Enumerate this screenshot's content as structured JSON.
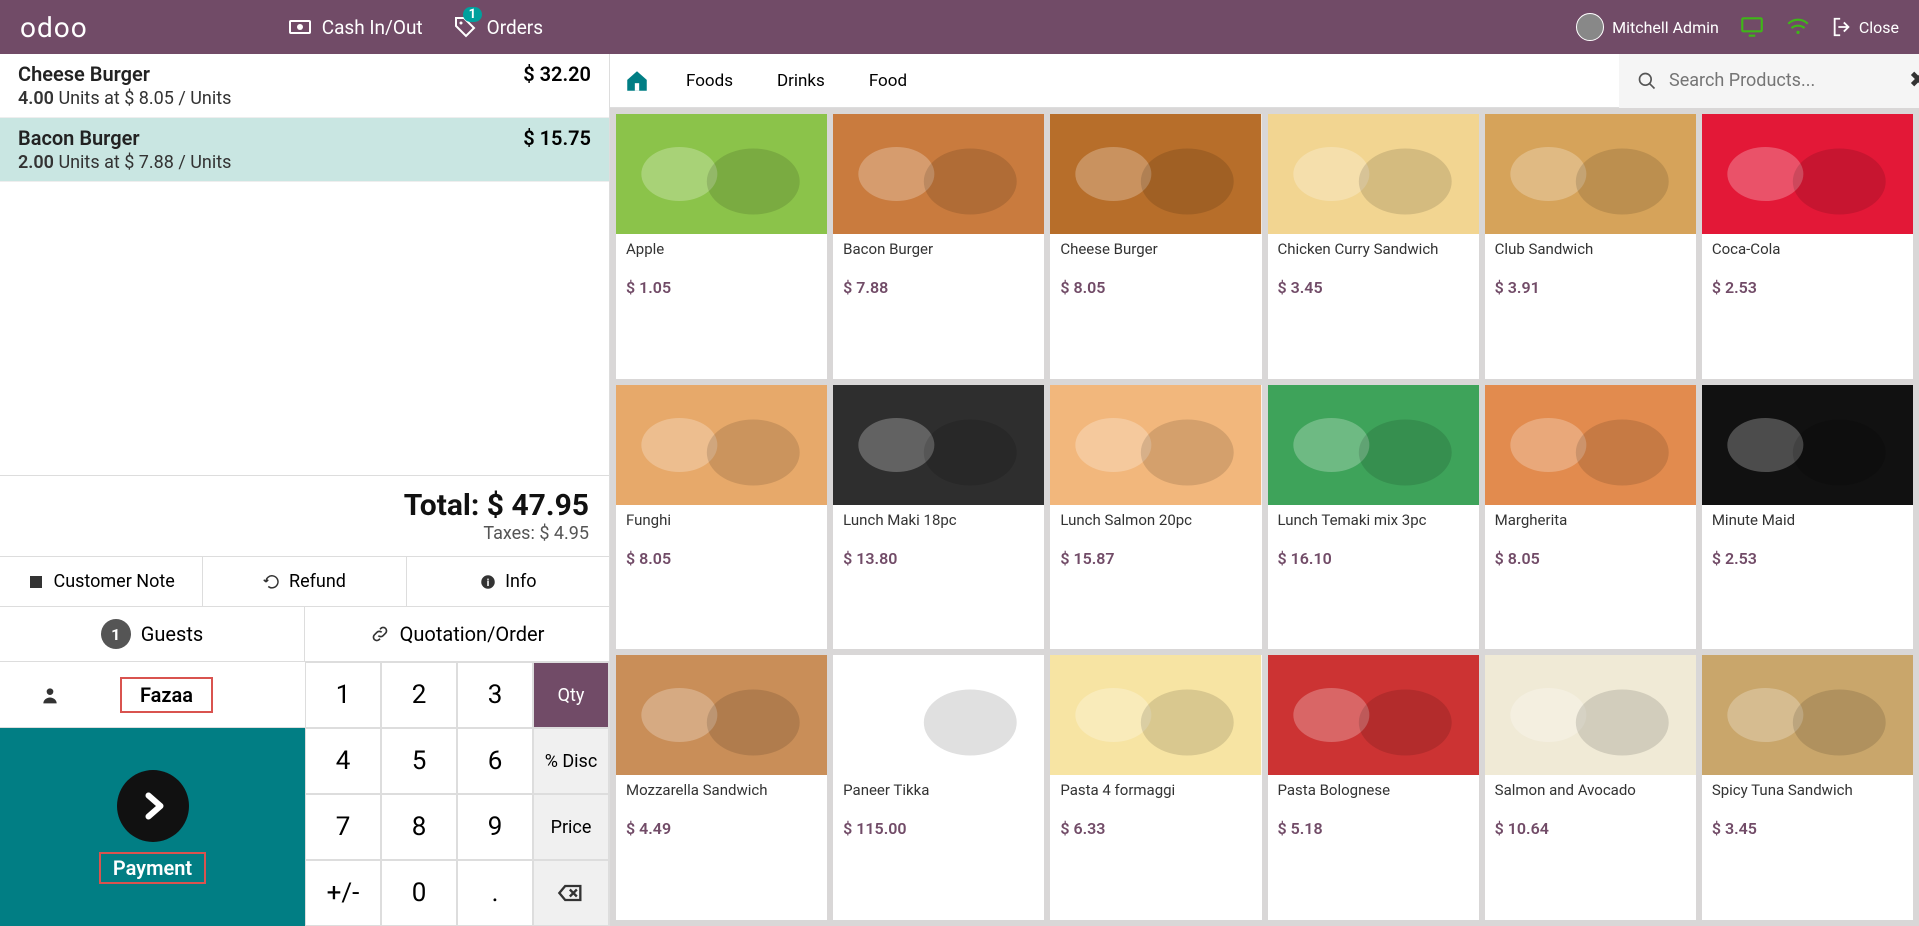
{
  "topbar": {
    "logo": "odoo",
    "cash_label": "Cash In/Out",
    "orders_label": "Orders",
    "orders_badge": "1",
    "user": "Mitchell Admin",
    "close_label": "Close"
  },
  "order": {
    "lines": [
      {
        "name": "Cheese Burger",
        "qty": "4.00",
        "unit_label": "Units at",
        "unit_price": "$ 8.05 / Units",
        "price": "$ 32.20",
        "selected": false
      },
      {
        "name": "Bacon Burger",
        "qty": "2.00",
        "unit_label": "Units at",
        "unit_price": "$ 7.88 / Units",
        "price": "$ 15.75",
        "selected": true
      }
    ],
    "total_label": "Total:",
    "total": "$ 47.95",
    "tax_label": "Taxes:",
    "tax": "$ 4.95"
  },
  "actions": {
    "note": "Customer Note",
    "refund": "Refund",
    "info": "Info"
  },
  "guests": {
    "count": "1",
    "label": "Guests",
    "quotation": "Quotation/Order"
  },
  "customer": {
    "name": "Fazaa"
  },
  "payment": {
    "label": "Payment"
  },
  "numpad": {
    "k1": "1",
    "k2": "2",
    "k3": "3",
    "qty": "Qty",
    "k4": "4",
    "k5": "5",
    "k6": "6",
    "disc": "% Disc",
    "k7": "7",
    "k8": "8",
    "k9": "9",
    "price": "Price",
    "pm": "+/-",
    "k0": "0"
  },
  "categories": {
    "foods": "Foods",
    "drinks": "Drinks",
    "food": "Food"
  },
  "search": {
    "placeholder": "Search Products..."
  },
  "products": [
    {
      "name": "Apple",
      "price": "$ 1.05",
      "color": "#8bc34a"
    },
    {
      "name": "Bacon Burger",
      "price": "$ 7.88",
      "color": "#c97b3e"
    },
    {
      "name": "Cheese Burger",
      "price": "$ 8.05",
      "color": "#b76e2a"
    },
    {
      "name": "Chicken Curry Sandwich",
      "price": "$ 3.45",
      "color": "#f2d591"
    },
    {
      "name": "Club Sandwich",
      "price": "$ 3.91",
      "color": "#d6a35a"
    },
    {
      "name": "Coca-Cola",
      "price": "$ 2.53",
      "color": "#e31837"
    },
    {
      "name": "Funghi",
      "price": "$ 8.05",
      "color": "#e7a96a"
    },
    {
      "name": "Lunch Maki 18pc",
      "price": "$ 13.80",
      "color": "#2e2e2e"
    },
    {
      "name": "Lunch Salmon 20pc",
      "price": "$ 15.87",
      "color": "#f2b77c"
    },
    {
      "name": "Lunch Temaki mix 3pc",
      "price": "$ 16.10",
      "color": "#3ea35a"
    },
    {
      "name": "Margherita",
      "price": "$ 8.05",
      "color": "#e28b4e"
    },
    {
      "name": "Minute Maid",
      "price": "$ 2.53",
      "color": "#111"
    },
    {
      "name": "Mozzarella Sandwich",
      "price": "$ 4.49",
      "color": "#c98e58"
    },
    {
      "name": "Paneer Tikka",
      "price": "$ 115.00",
      "color": "#fff"
    },
    {
      "name": "Pasta 4 formaggi",
      "price": "$ 6.33",
      "color": "#f7e4a3"
    },
    {
      "name": "Pasta Bolognese",
      "price": "$ 5.18",
      "color": "#c33"
    },
    {
      "name": "Salmon and Avocado",
      "price": "$ 10.64",
      "color": "#f0ead6"
    },
    {
      "name": "Spicy Tuna Sandwich",
      "price": "$ 3.45",
      "color": "#c9a66b"
    }
  ]
}
